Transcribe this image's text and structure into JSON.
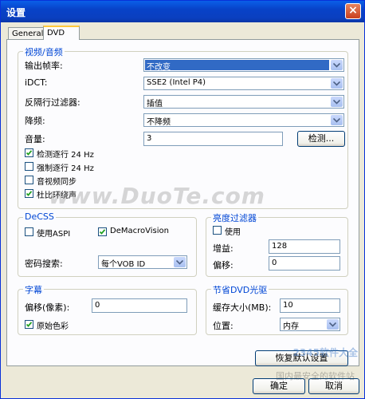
{
  "window": {
    "title": "设置",
    "close": "×"
  },
  "tabs": [
    {
      "label": "General"
    },
    {
      "label": "DVD"
    }
  ],
  "video_audio": {
    "title": "视频/音频",
    "output_rate": {
      "label": "输出帧率:",
      "value": "不改变"
    },
    "idct": {
      "label": "iDCT:",
      "value": "SSE2 (Intel P4)"
    },
    "deinterlace": {
      "label": "反隔行过滤器:",
      "value": "插值"
    },
    "downsample": {
      "label": "降频:",
      "value": "不降频"
    },
    "volume": {
      "label": "音量:",
      "value": "3",
      "detect_button": "检测..."
    },
    "checks": [
      {
        "label": "检测逐行 24 Hz",
        "checked": true
      },
      {
        "label": "强制逐行 24 Hz",
        "checked": false
      },
      {
        "label": "音视频同步",
        "checked": false
      },
      {
        "label": "杜比环绕声",
        "checked": true
      }
    ]
  },
  "decss": {
    "title": "DeCSS",
    "use_aspi": {
      "label": "使用ASPI",
      "checked": false
    },
    "demacrovision": {
      "label": "DeMacroVision",
      "checked": true
    },
    "key_search": {
      "label": "密码搜索:",
      "value": "每个VOB ID"
    }
  },
  "luma": {
    "title": "亮度过滤器",
    "use": {
      "label": "使用",
      "checked": false
    },
    "gain": {
      "label": "增益:",
      "value": "128"
    },
    "offset": {
      "label": "偏移:",
      "value": "0"
    }
  },
  "subtitles": {
    "title": "字幕",
    "offset": {
      "label": "偏移(像素):",
      "value": "0"
    },
    "original_color": {
      "label": "原始色彩",
      "checked": true
    }
  },
  "dvd_saver": {
    "title": "节省DVD光驱",
    "cache": {
      "label": "缓存大小(MB):",
      "value": "10"
    },
    "location": {
      "label": "位置:",
      "value": "内存"
    }
  },
  "buttons": {
    "restore": "恢复默认设置",
    "ok": "确定",
    "cancel": "取消"
  },
  "watermarks": {
    "main": "www.DuoTe.com",
    "corner": "2345软件大全",
    "footer": "国内最安全的软件站"
  },
  "colors": {
    "titlebar": "#0a5fe8",
    "group_title": "#0046d5",
    "selection": "#316ac5"
  }
}
